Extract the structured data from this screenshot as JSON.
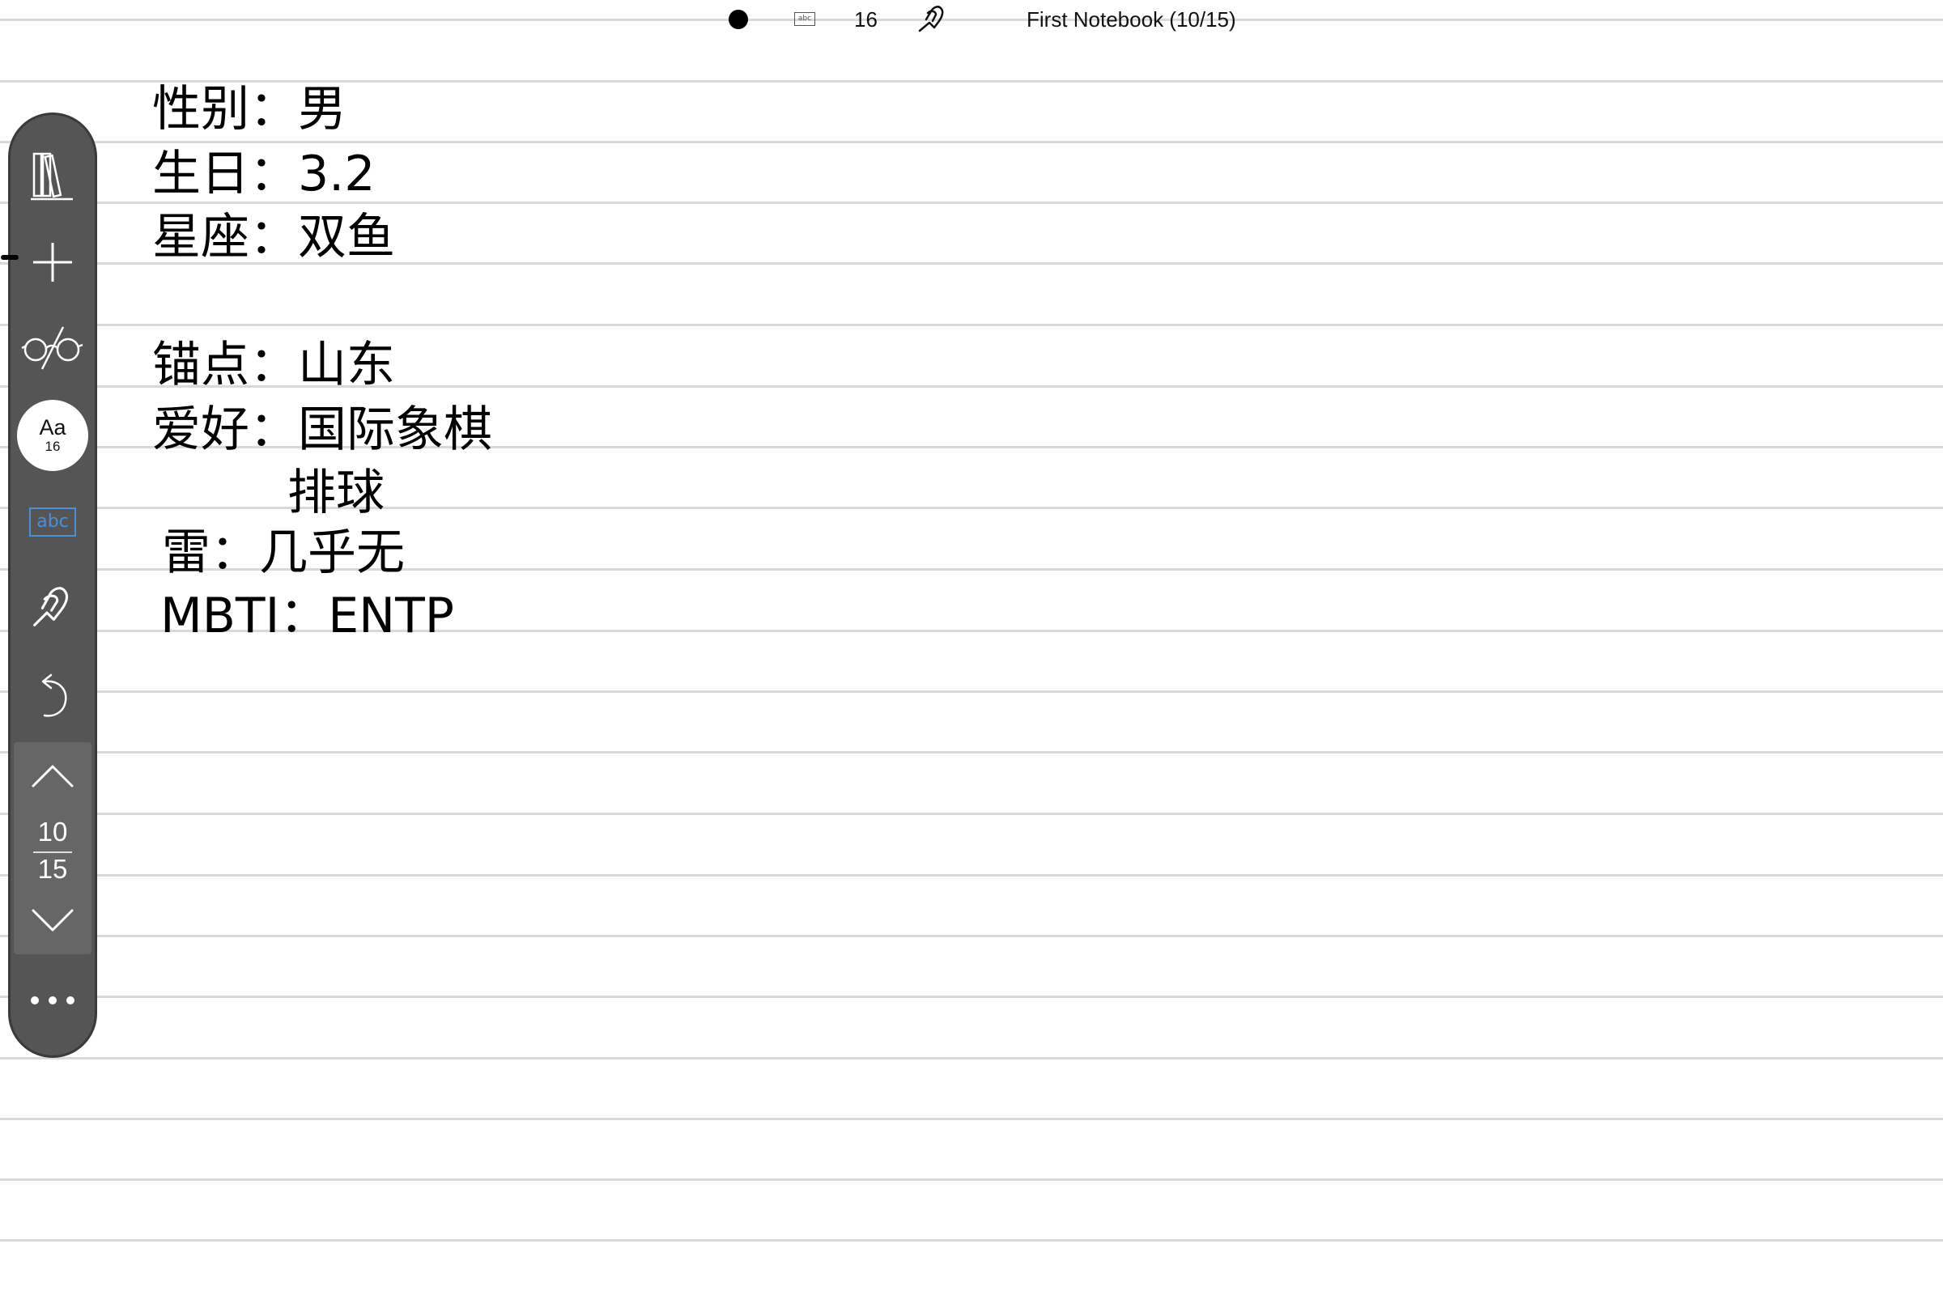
{
  "status_bar": {
    "pen_size": "16",
    "mode_icon": "abc",
    "title": "First Notebook (10/15)"
  },
  "notebook": {
    "lines": [
      "性别：男",
      "生日：3.2",
      "星座：双鱼",
      "锚点：山东",
      "爱好：国际象棋",
      "排球",
      "雷：几乎无",
      "MBTI：ENTP"
    ]
  },
  "toolbar": {
    "icons": [
      "library-icon",
      "add-icon",
      "glasses-icon",
      "font-size-icon",
      "keyboard-text-icon",
      "hand-icon",
      "undo-icon",
      "page-up-icon",
      "page-down-icon",
      "more-icon"
    ],
    "font_aa": "Aa",
    "font_size": "16",
    "abc_label": "abc",
    "page_current": "10",
    "page_total": "15"
  },
  "colors": {
    "toolbar_bg": "#555555",
    "abc_accent": "#4a90d9",
    "rule_line": "#d9d9d9"
  }
}
